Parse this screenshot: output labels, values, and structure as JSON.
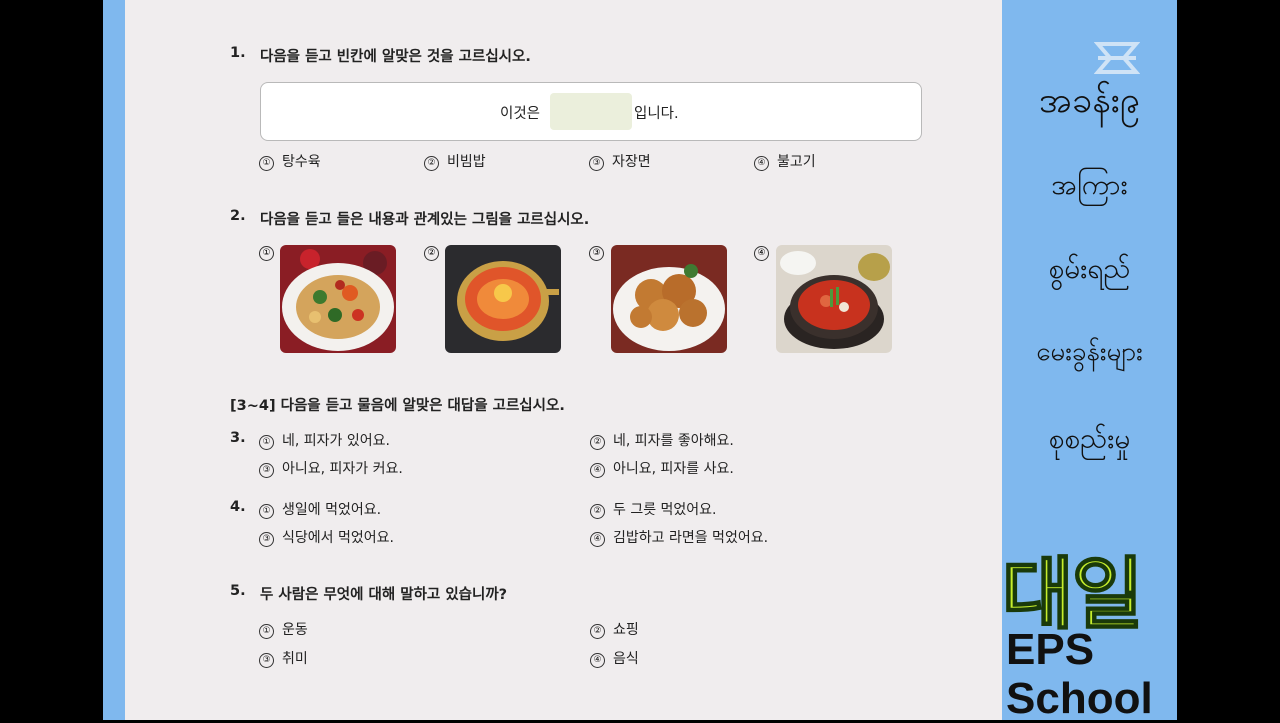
{
  "q1": {
    "num": "1.",
    "title": "다음을 듣고 빈칸에 알맞은 것을 고르십시오.",
    "sentence_before": "이것은",
    "sentence_after": "입니다.",
    "options": [
      {
        "mark": "①",
        "text": "탕수육"
      },
      {
        "mark": "②",
        "text": "비빔밥"
      },
      {
        "mark": "③",
        "text": "자장면"
      },
      {
        "mark": "④",
        "text": "불고기"
      }
    ]
  },
  "q2": {
    "num": "2.",
    "title": "다음을 듣고 들은 내용과 관계있는 그림을 고르십시오.",
    "marks": [
      "①",
      "②",
      "③",
      "④"
    ],
    "images": [
      "stir-fry-dish",
      "ramen-pot",
      "fried-chicken",
      "stew-pot"
    ]
  },
  "group": {
    "title": "[3~4] 다음을 듣고 물음에 알맞은 대답을 고르십시오."
  },
  "q3": {
    "num": "3.",
    "options": [
      {
        "mark": "①",
        "text": "네, 피자가 있어요."
      },
      {
        "mark": "②",
        "text": "네, 피자를 좋아해요."
      },
      {
        "mark": "③",
        "text": "아니요, 피자가 커요."
      },
      {
        "mark": "④",
        "text": "아니요, 피자를 사요."
      }
    ]
  },
  "q4": {
    "num": "4.",
    "options": [
      {
        "mark": "①",
        "text": "생일에 먹었어요."
      },
      {
        "mark": "②",
        "text": "두 그릇 먹었어요."
      },
      {
        "mark": "③",
        "text": "식당에서 먹었어요."
      },
      {
        "mark": "④",
        "text": "김밥하고 라면을 먹었어요."
      }
    ]
  },
  "q5": {
    "num": "5.",
    "title": "두 사람은 무엇에 대해 말하고 있습니까?",
    "options": [
      {
        "mark": "①",
        "text": "운동"
      },
      {
        "mark": "②",
        "text": "쇼핑"
      },
      {
        "mark": "③",
        "text": "취미"
      },
      {
        "mark": "④",
        "text": "음식"
      }
    ]
  },
  "side": {
    "lines": [
      "အခန်း၉",
      "အကြား",
      "စွမ်းရည်",
      "မေးခွန်းများ",
      "စုစည်းမှု"
    ],
    "brand_ko": "대일",
    "brand_en1": "EPS",
    "brand_en2": "School",
    "logo_icon": "capcut-logo-icon"
  },
  "colors": {
    "accent_blue": "#7fb8ee",
    "page_bg": "#f0edee",
    "brand_green": "#c6ee2c",
    "blank_fill": "#ebefdc"
  }
}
